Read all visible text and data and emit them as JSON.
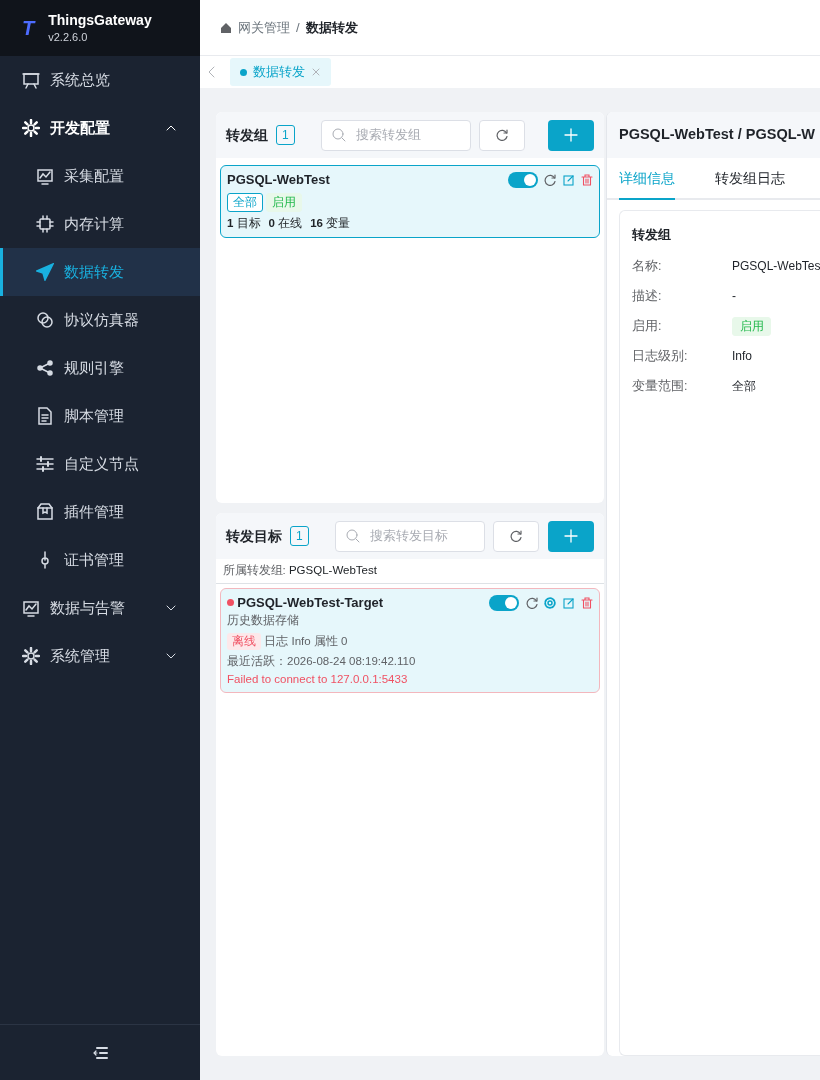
{
  "app": {
    "logo": "T",
    "name": "ThingsGateway",
    "version": "v2.2.6.0"
  },
  "sidebar": {
    "items": [
      {
        "label": "系统总览",
        "selected": false
      },
      {
        "label": "开发配置",
        "selected": false,
        "expanded": true,
        "children": [
          {
            "label": "采集配置",
            "selected": false
          },
          {
            "label": "内存计算",
            "selected": false
          },
          {
            "label": "数据转发",
            "selected": true
          },
          {
            "label": "协议仿真器",
            "selected": false
          },
          {
            "label": "规则引擎",
            "selected": false
          },
          {
            "label": "脚本管理",
            "selected": false
          },
          {
            "label": "自定义节点",
            "selected": false
          },
          {
            "label": "插件管理",
            "selected": false
          },
          {
            "label": "证书管理",
            "selected": false
          }
        ]
      },
      {
        "label": "数据与告警",
        "selected": false,
        "expanded": false
      },
      {
        "label": "系统管理",
        "selected": false,
        "expanded": false
      }
    ]
  },
  "breadcrumb": {
    "separator": "/",
    "items": [
      "网关管理",
      "数据转发"
    ]
  },
  "page_tabs": [
    {
      "label": "数据转发",
      "selected": true
    }
  ],
  "groups_panel": {
    "title": "转发组",
    "count": "1",
    "search": {
      "placeholder": "搜索转发组"
    },
    "items": [
      {
        "name": "PGSQL-WebTest",
        "enabled": true,
        "selected": true,
        "tags": [
          {
            "text": "全部",
            "kind": "outline"
          },
          {
            "text": "启用",
            "kind": "success"
          }
        ],
        "stats": [
          "**1** 目标",
          "**0** 在线",
          "**16** 变量"
        ]
      }
    ]
  },
  "targets_panel": {
    "title": "转发目标",
    "count": "1",
    "search": {
      "placeholder": "搜索转发目标"
    },
    "group_label": "所属转发组:",
    "group_name": "PGSQL-WebTest",
    "items": [
      {
        "name": "PGSQL-WebTest-Target",
        "online": false,
        "enabled": true,
        "selected": true,
        "description": "历史数据存储",
        "status": "离线",
        "meta": "日志 Info 属性 0",
        "last_active": "最近活跃：2026-08-24 08:19:42.110",
        "error": "Failed to connect to 127.0.0.1:5433"
      }
    ]
  },
  "detail": {
    "title": "PGSQL-WebTest / PGSQL-W",
    "tabs": [
      {
        "label": "详细信息",
        "selected": true
      },
      {
        "label": "转发组日志",
        "selected": false
      }
    ],
    "section": "转发组",
    "fields": [
      {
        "label": "名称:",
        "value": "PGSQL-WebTes",
        "kind": "text"
      },
      {
        "label": "描述:",
        "value": "-",
        "kind": "text"
      },
      {
        "label": "启用:",
        "value": "启用",
        "kind": "badge"
      },
      {
        "label": "日志级别:",
        "value": "Info",
        "kind": "text"
      },
      {
        "label": "变量范围:",
        "value": "全部",
        "kind": "text"
      }
    ]
  }
}
